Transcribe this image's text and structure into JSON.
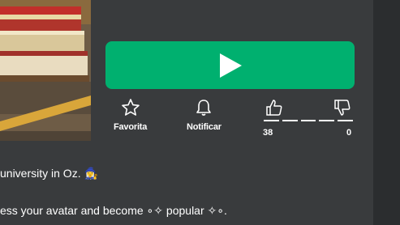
{
  "game": {
    "play_icon": "play-icon",
    "favorite_label": "Favorita",
    "notify_label": "Notificar",
    "upvotes": "38",
    "downvotes": "0"
  },
  "description": {
    "line1": "university in Oz. 🧙‍♀️",
    "line2": "ess your avatar and become ∘✧ popular ✧∘."
  },
  "colors": {
    "play": "#00b06f",
    "background": "#393b3d"
  }
}
